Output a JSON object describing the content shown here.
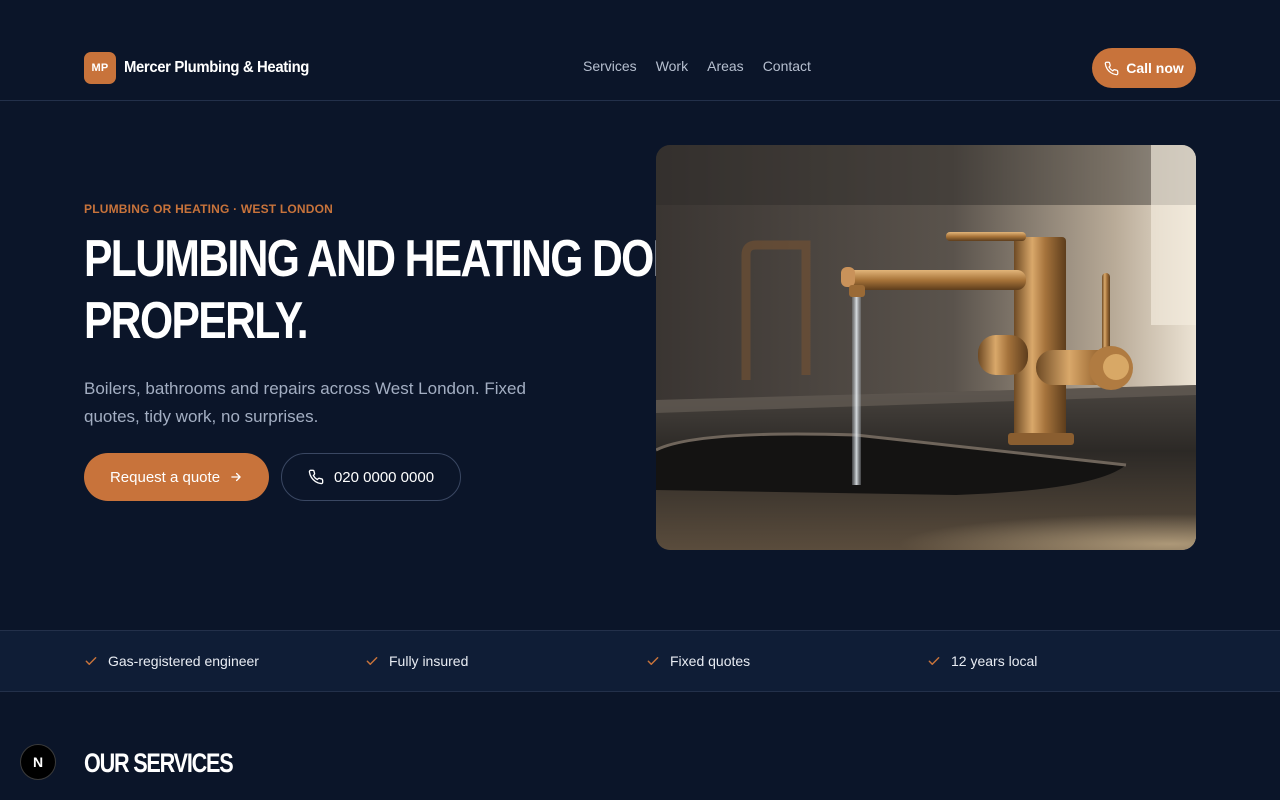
{
  "brand": {
    "initials": "MP",
    "name": "Mercer Plumbing & Heating"
  },
  "nav": {
    "items": [
      {
        "label": "Services"
      },
      {
        "label": "Work"
      },
      {
        "label": "Areas"
      },
      {
        "label": "Contact"
      }
    ]
  },
  "header": {
    "cta_label": "Call now"
  },
  "hero": {
    "eyebrow": "PLUMBING OR HEATING · WEST LONDON",
    "title_line1": "PLUMBING AND HEATING DONE",
    "title_line2": "PROPERLY.",
    "subtitle": "Boilers, bathrooms and repairs across West London. Fixed quotes, tidy work, no surprises.",
    "primary_cta": "Request a quote",
    "phone": "020 0000 0000"
  },
  "trust": {
    "items": [
      {
        "label": "Gas-registered engineer"
      },
      {
        "label": "Fully insured"
      },
      {
        "label": "Fixed quotes"
      },
      {
        "label": "12 years local"
      }
    ]
  },
  "services": {
    "title": "OUR SERVICES"
  },
  "dev_badge": {
    "label": "N"
  },
  "colors": {
    "accent": "#c8733b",
    "background": "#0b1529",
    "band": "#0f1d36",
    "muted_text": "#a3aec2"
  },
  "icons": {
    "phone": "phone-icon",
    "arrow": "arrow-right-icon",
    "check": "check-icon"
  }
}
